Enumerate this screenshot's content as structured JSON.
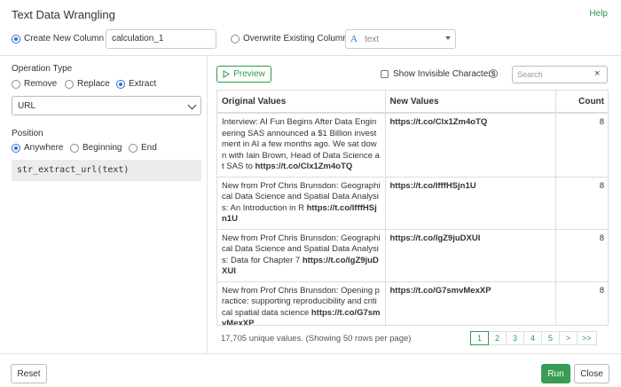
{
  "dialog": {
    "title": "Text Data Wrangling",
    "help": "Help"
  },
  "target": {
    "create_label": "Create New Column",
    "new_column_value": "calculation_1",
    "overwrite_label": "Overwrite Existing Column",
    "existing_column_value": "text",
    "existing_column_type_icon": "A"
  },
  "operation": {
    "label": "Operation Type",
    "options": [
      "Remove",
      "Replace",
      "Extract"
    ],
    "selected": "Extract",
    "pattern_value": "URL"
  },
  "position": {
    "label": "Position",
    "options": [
      "Anywhere",
      "Beginning",
      "End"
    ],
    "selected": "Anywhere",
    "expression": "str_extract_url(text)"
  },
  "preview": {
    "button_label": "Preview",
    "show_invisible_label": "Show Invisible Characters",
    "help_glyph": "?",
    "search_placeholder": "Search",
    "clear_glyph": "×"
  },
  "table": {
    "columns": [
      "Original Values",
      "New Values",
      "Count"
    ],
    "rows": [
      {
        "original_pre": "Interview: AI Fun Begins After Data Engineering SAS announced a $1 Billion investment in AI a few months ago. We sat down with Iain Brown, Head of Data Science at SAS to ",
        "original_bold": "https://t.co/Clx1Zm4oTQ",
        "new": "https://t.co/Clx1Zm4oTQ",
        "count": "8"
      },
      {
        "original_pre": "New from Prof Chris Brunsdon: Geographical Data Science and Spatial Data Analysis: An Introduction in R ",
        "original_bold": "https://t.co/IfffHSjn1U",
        "new": "https://t.co/IfffHSjn1U",
        "count": "8"
      },
      {
        "original_pre": "New from Prof Chris Brunsdon: Geographical Data Science and Spatial Data Analysis: Data for Chapter 7 ",
        "original_bold": "https://t.co/IgZ9juDXUI",
        "new": "https://t.co/IgZ9juDXUI",
        "count": "8"
      },
      {
        "original_pre": "New from Prof Chris Brunsdon: Opening practice: supporting reproducibility and critical spatial data science ",
        "original_bold": "https://t.co/G7smvMexXP",
        "new": "https://t.co/G7smvMexXP",
        "count": "8"
      }
    ]
  },
  "footer": {
    "info": "17,705 unique values. (Showing 50 rows per page)",
    "pages": [
      "1",
      "2",
      "3",
      "4",
      "5",
      ">",
      ">>"
    ],
    "active_page": "1"
  },
  "actions": {
    "reset": "Reset",
    "run": "Run",
    "close": "Close"
  },
  "colors": {
    "accent_green": "#2e9a4a",
    "radio_blue": "#2f6fd6"
  }
}
